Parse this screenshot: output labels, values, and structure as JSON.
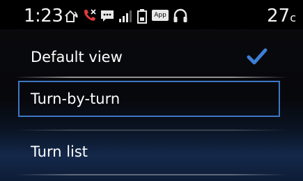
{
  "status_bar": {
    "time": "1:23",
    "temperature": "27",
    "temperature_unit": "c",
    "icons": [
      "house-signal-icon",
      "phone-missed-icon",
      "message-icon",
      "signal-bars-icon",
      "battery-icon",
      "app-icon",
      "headset-icon"
    ],
    "app_badge": "App",
    "accent_phone_color": "#e03a3a"
  },
  "menu": {
    "items": [
      {
        "label": "Default view",
        "checked": true
      },
      {
        "label": "Turn-by-turn",
        "focused": true
      },
      {
        "label": "Turn list"
      }
    ]
  },
  "colors": {
    "check": "#3d7fd6",
    "focus_border": "#3f77c4"
  }
}
